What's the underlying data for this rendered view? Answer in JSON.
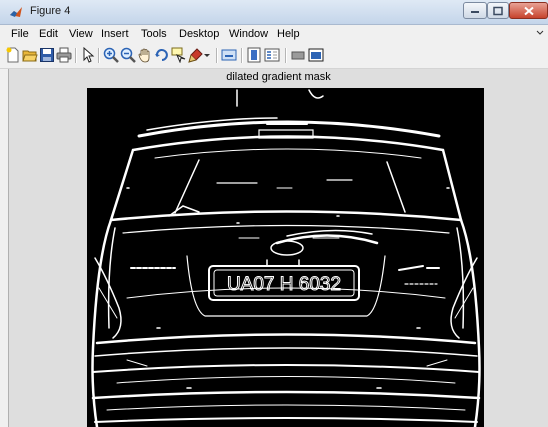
{
  "window": {
    "title": "Figure 4",
    "accent_color": "#c7432d"
  },
  "menubar": {
    "items": [
      {
        "label": "File"
      },
      {
        "label": "Edit"
      },
      {
        "label": "View"
      },
      {
        "label": "Insert"
      },
      {
        "label": "Tools"
      },
      {
        "label": "Desktop"
      },
      {
        "label": "Window"
      },
      {
        "label": "Help"
      }
    ]
  },
  "toolbar": {
    "icons": [
      "new-figure-icon",
      "open-file-icon",
      "save-figure-icon",
      "print-figure-icon",
      "edit-plot-arrow-icon",
      "zoom-in-icon",
      "zoom-out-icon",
      "pan-hand-icon",
      "rotate-3d-icon",
      "data-cursor-icon",
      "brush-icon",
      "brush-dropdown-icon",
      "link-plot-icon",
      "insert-colorbar-icon",
      "insert-legend-icon",
      "hide-plot-tools-icon",
      "show-plot-tools-icon"
    ]
  },
  "figure": {
    "title": "dilated gradient mask",
    "plate_text": "UA07 H 6032",
    "colors": {
      "background": "#000000",
      "edges": "#ffffff"
    }
  }
}
